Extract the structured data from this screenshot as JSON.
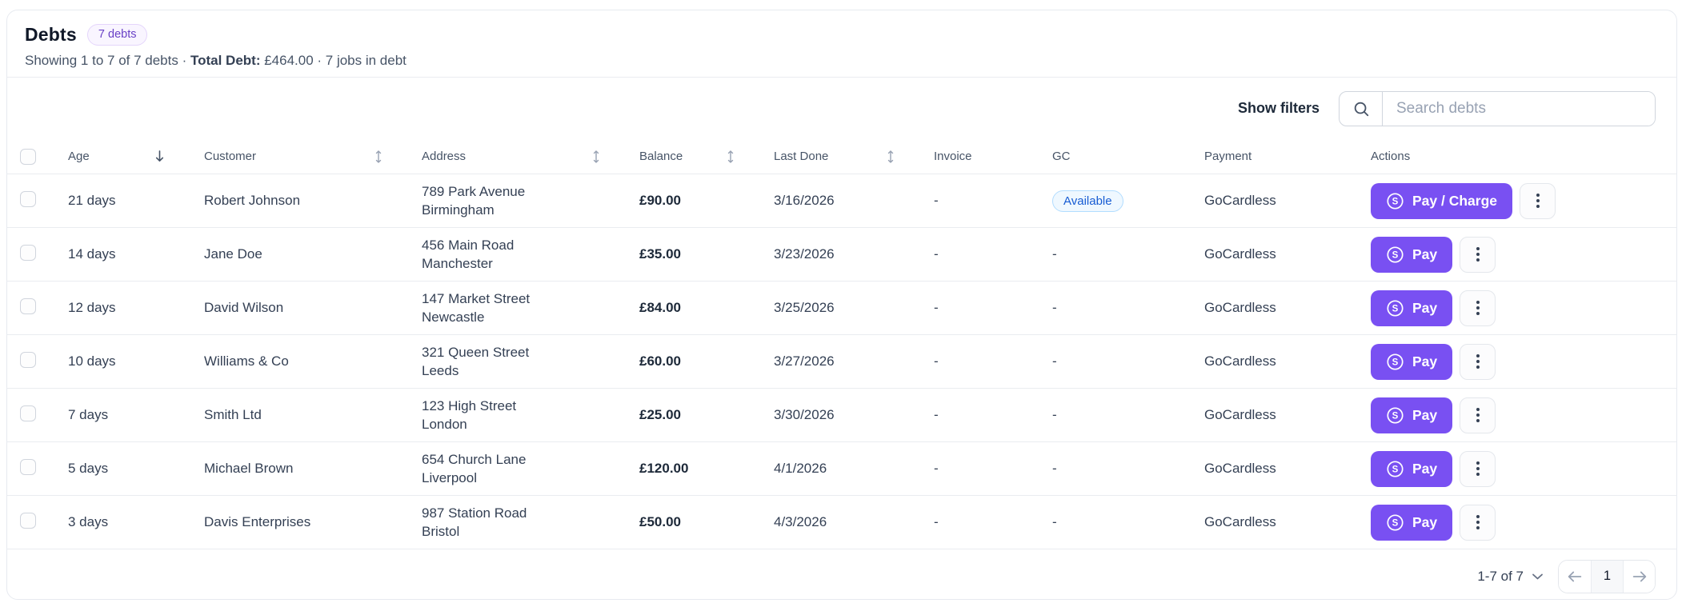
{
  "page": {
    "title": "Debts",
    "count_badge": "7 debts",
    "subtitle_prefix": "Showing 1 to 7 of 7 debts · ",
    "subtitle_bold": "Total Debt:",
    "subtitle_suffix": " £464.00 · 7 jobs in debt"
  },
  "toolbar": {
    "show_filters_label": "Show filters",
    "search_placeholder": "Search debts",
    "search_value": ""
  },
  "table": {
    "columns": [
      {
        "label": "Age",
        "sort": "desc"
      },
      {
        "label": "Customer",
        "sort": "both"
      },
      {
        "label": "Address",
        "sort": "both"
      },
      {
        "label": "Balance",
        "sort": "both"
      },
      {
        "label": "Last Done",
        "sort": "both"
      },
      {
        "label": "Invoice",
        "sort": "none"
      },
      {
        "label": "GC",
        "sort": "none"
      },
      {
        "label": "Payment",
        "sort": "none"
      },
      {
        "label": "Actions",
        "sort": "none"
      }
    ],
    "rows": [
      {
        "age": "21 days",
        "customer": "Robert Johnson",
        "address_line1": "789 Park Avenue",
        "address_line2": "Birmingham",
        "balance": "£90.00",
        "last_done": "3/16/2026",
        "invoice": "-",
        "gc": "Available",
        "payment": "GoCardless",
        "action": "Pay / Charge"
      },
      {
        "age": "14 days",
        "customer": "Jane Doe",
        "address_line1": "456 Main Road",
        "address_line2": "Manchester",
        "balance": "£35.00",
        "last_done": "3/23/2026",
        "invoice": "-",
        "gc": "-",
        "payment": "GoCardless",
        "action": "Pay"
      },
      {
        "age": "12 days",
        "customer": "David Wilson",
        "address_line1": "147 Market Street",
        "address_line2": "Newcastle",
        "balance": "£84.00",
        "last_done": "3/25/2026",
        "invoice": "-",
        "gc": "-",
        "payment": "GoCardless",
        "action": "Pay"
      },
      {
        "age": "10 days",
        "customer": "Williams & Co",
        "address_line1": "321 Queen Street",
        "address_line2": "Leeds",
        "balance": "£60.00",
        "last_done": "3/27/2026",
        "invoice": "-",
        "gc": "-",
        "payment": "GoCardless",
        "action": "Pay"
      },
      {
        "age": "7 days",
        "customer": "Smith Ltd",
        "address_line1": "123 High Street",
        "address_line2": "London",
        "balance": "£25.00",
        "last_done": "3/30/2026",
        "invoice": "-",
        "gc": "-",
        "payment": "GoCardless",
        "action": "Pay"
      },
      {
        "age": "5 days",
        "customer": "Michael Brown",
        "address_line1": "654 Church Lane",
        "address_line2": "Liverpool",
        "balance": "£120.00",
        "last_done": "4/1/2026",
        "invoice": "-",
        "gc": "-",
        "payment": "GoCardless",
        "action": "Pay"
      },
      {
        "age": "3 days",
        "customer": "Davis Enterprises",
        "address_line1": "987 Station Road",
        "address_line2": "Bristol",
        "balance": "£50.00",
        "last_done": "4/3/2026",
        "invoice": "-",
        "gc": "-",
        "payment": "GoCardless",
        "action": "Pay"
      }
    ]
  },
  "pagination": {
    "range_label": "1-7 of 7",
    "current_page": "1"
  },
  "icons": {
    "search": "magnifier",
    "sort_desc": "arrow-down",
    "sort_both": "up-down-arrow",
    "pay": "circled-s-currency",
    "kebab": "vertical-ellipsis",
    "range_dropdown": "chevron-down",
    "prev": "arrow-left",
    "next": "arrow-right"
  },
  "colors": {
    "accent_purple": "#7950f2",
    "badge_purple_text": "#6941c6",
    "badge_purple_bg": "#f9f5ff",
    "available_text": "#175cd3",
    "available_bg": "#eff8ff",
    "border": "#eaecf0"
  }
}
